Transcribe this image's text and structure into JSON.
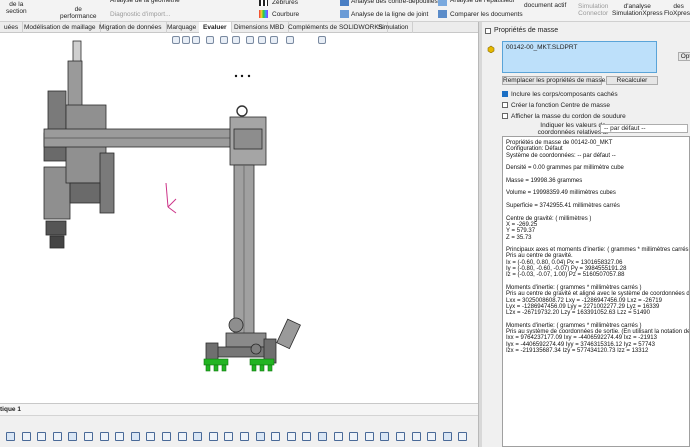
{
  "ribbon": {
    "items": [
      {
        "label": "de la\nsection",
        "dim": false
      },
      {
        "label": "de\nperformance",
        "dim": false
      },
      {
        "label": "Analyse de la géométrie",
        "dim": false
      },
      {
        "label": "Diagnostic d'import...",
        "dim": true
      },
      {
        "label": "Courbure",
        "dim": false
      },
      {
        "label": "Zébrures",
        "dim": false
      },
      {
        "label": "Analyse des contre-dépouilles",
        "dim": false
      },
      {
        "label": "Analyse de la ligne de joint",
        "dim": false
      },
      {
        "label": "Analyse de l'épaisseur",
        "dim": false
      },
      {
        "label": "Comparer les documents",
        "dim": false
      },
      {
        "label": "document actif",
        "dim": false
      },
      {
        "label": "Simulation\nConnector",
        "dim": true
      },
      {
        "label": "d'analyse\nSimulationXpress",
        "dim": false
      },
      {
        "label": "des\nFloXpress",
        "dim": false
      }
    ]
  },
  "tabs": [
    "uées",
    "Modélisation de maillage",
    "Migration de données",
    "Marquage",
    "Evaluer",
    "Dimensions MBD",
    "Compléments de SOLIDWORKS",
    "Simulation"
  ],
  "active_tab": "Evaluer",
  "status": {
    "tab_label": "tique 1"
  },
  "panel": {
    "title": "Propriétés de masse",
    "selection": "00142-00_MKT.SLDPRT",
    "options_button": "Opt",
    "replace_button": "Remplacer les propriétés de masse...",
    "recalc_button": "Recalculer",
    "checks": [
      {
        "label": "Inclure les corps/composants cachés",
        "checked": true
      },
      {
        "label": "Créer la fonction Centre de masse",
        "checked": false
      },
      {
        "label": "Afficher la masse du cordon de soudure",
        "checked": false
      }
    ],
    "relative_label": "Indiquer les valeurs de\ncoordonnées relatives à:",
    "relative_value": "-- par défaut --"
  },
  "results": [
    "Propriétés de masse de 00142-00_MKT",
    "     Configuration: Défaut",
    "     Système de coordonnées: -- par défaut --",
    "",
    "Densité = 0.00 grammes par millimètre cube",
    "",
    "Masse = 19998.36 grammes",
    "",
    "Volume = 19998359.49 millimètres cubes",
    "",
    "Superficie = 3742955.41  millimètres carrés",
    "",
    "Centre de gravité: ( millimètres )",
    "          X = -269.25",
    "          Y = 579.37",
    "          Z = 35.73",
    "",
    "Principaux axes et moments d'inertie: ( grammes *  millimètres carrés )",
    "Pris au centre de gravité.",
    "          Ix = (-0.60,  0.80,  0.04)     Px = 1301658327.06",
    "          Iy = (-0.80, -0.60, -0.07)     Py = 3984555191.28",
    "          Iz = (-0.03, -0.07,  1.00)     Pz = 5160507057.88",
    "",
    "Moments d'inertie: ( grammes *  millimètres carrés )",
    "Pris au centre de gravité et aligné avec le système de coordonnées de s",
    "          Lxx = 3025008608.72        Lxy = -1286947456.09        Lxz = -26719",
    "          Lyx = -1286947456.09       Lyy = 2271002277.29         Lyz = 16339",
    "          Lzx = -26719732.20         Lzy = 163391052.63          Lzz = 51490",
    "",
    "Moments d'inertie: ( grammes *  millimètres carrés )",
    "Pris au système de coordonnées de sortie. (En utilisant la notation de te",
    "          Ixx = 9764237177.09        Ixy = -4406592274.49        Ixz = -21913",
    "          Iyx = -4406592274.49       Iyy = 3746315316.12         Iyz = 57743",
    "          Izx = -219135687.34        Izy = 577434120.73          Izz = 13312"
  ]
}
